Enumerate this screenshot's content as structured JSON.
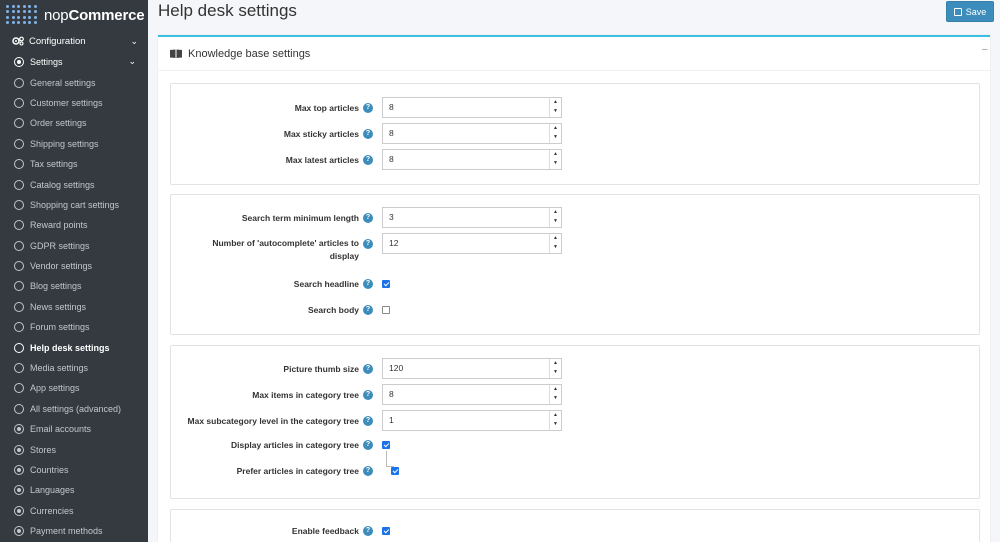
{
  "brand": {
    "part1": "nop",
    "part2": "Commerce"
  },
  "sidebar": {
    "section": "Configuration",
    "items": [
      {
        "label": "Settings",
        "type": "header"
      },
      {
        "label": "General settings"
      },
      {
        "label": "Customer settings"
      },
      {
        "label": "Order settings"
      },
      {
        "label": "Shipping settings"
      },
      {
        "label": "Tax settings"
      },
      {
        "label": "Catalog settings"
      },
      {
        "label": "Shopping cart settings"
      },
      {
        "label": "Reward points"
      },
      {
        "label": "GDPR settings"
      },
      {
        "label": "Vendor settings"
      },
      {
        "label": "Blog settings"
      },
      {
        "label": "News settings"
      },
      {
        "label": "Forum settings"
      },
      {
        "label": "Help desk settings",
        "active": true
      },
      {
        "label": "Media settings"
      },
      {
        "label": "App settings"
      },
      {
        "label": "All settings (advanced)"
      },
      {
        "label": "Email accounts",
        "type": "dot"
      },
      {
        "label": "Stores",
        "type": "dot"
      },
      {
        "label": "Countries",
        "type": "dot"
      },
      {
        "label": "Languages",
        "type": "dot"
      },
      {
        "label": "Currencies",
        "type": "dot"
      },
      {
        "label": "Payment methods",
        "type": "dot"
      }
    ]
  },
  "header": {
    "title": "Help desk settings",
    "save_label": "Save"
  },
  "card": {
    "title": "Knowledge base settings",
    "collapse": "−"
  },
  "panel1": {
    "max_top_label": "Max top articles",
    "max_top_value": "8",
    "max_sticky_label": "Max sticky articles",
    "max_sticky_value": "8",
    "max_latest_label": "Max latest articles",
    "max_latest_value": "8"
  },
  "panel2": {
    "search_min_label": "Search term minimum length",
    "search_min_value": "3",
    "autocomplete_label_1": "Number of 'autocomplete' articles to",
    "autocomplete_label_2": "display",
    "autocomplete_value": "12",
    "search_headline_label": "Search headline",
    "search_headline_checked": true,
    "search_body_label": "Search body",
    "search_body_checked": false
  },
  "panel3": {
    "thumb_label": "Picture thumb size",
    "thumb_value": "120",
    "max_items_label": "Max items in category tree",
    "max_items_value": "8",
    "max_sub_label": "Max subcategory level in the category tree",
    "max_sub_value": "1",
    "display_label": "Display articles in category tree",
    "display_checked": true,
    "prefer_label": "Prefer articles in category tree",
    "prefer_checked": true
  },
  "panel4": {
    "feedback_label": "Enable feedback",
    "feedback_checked": true
  },
  "help_glyph": "?",
  "spin_up": "▲",
  "spin_down": "▼",
  "chevron": "⌄"
}
